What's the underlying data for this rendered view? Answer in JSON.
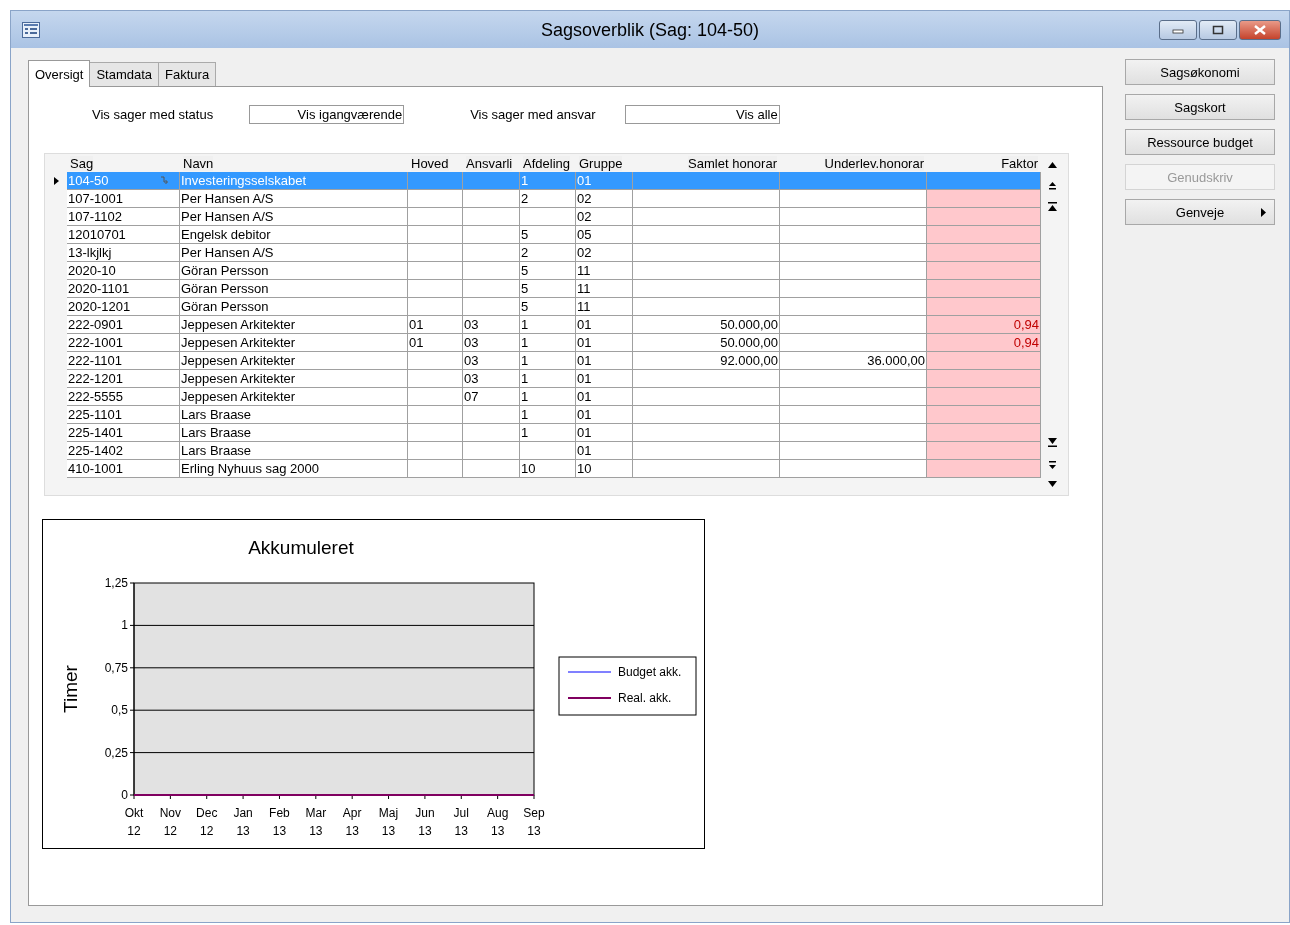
{
  "window": {
    "title": "Sagsoverblik (Sag: 104-50)"
  },
  "tabs": [
    {
      "label": "Oversigt",
      "selected": true
    },
    {
      "label": "Stamdata",
      "selected": false
    },
    {
      "label": "Faktura",
      "selected": false
    }
  ],
  "filters": [
    {
      "label": "Vis sager med status",
      "value": "Vis igangværende"
    },
    {
      "label": "Vis sager med ansvar",
      "value": "Vis alle"
    }
  ],
  "table": {
    "columns": [
      "Sag",
      "Navn",
      "Hoved",
      "Ansvarli",
      "Afdeling",
      "Gruppe",
      "Samlet honorar",
      "Underlev.honorar",
      "Faktor"
    ],
    "rows": [
      {
        "cells": [
          "104-50",
          "Investeringsselskabet",
          "",
          "",
          "1",
          "01",
          "",
          "",
          ""
        ],
        "selected": true
      },
      {
        "cells": [
          "107-1001",
          "Per Hansen A/S",
          "",
          "",
          "2",
          "02",
          "",
          "",
          ""
        ],
        "selected": false
      },
      {
        "cells": [
          "107-1102",
          "Per Hansen A/S",
          "",
          "",
          "",
          "02",
          "",
          "",
          ""
        ],
        "selected": false
      },
      {
        "cells": [
          "12010701",
          "Engelsk debitor",
          "",
          "",
          "5",
          "05",
          "",
          "",
          ""
        ],
        "selected": false
      },
      {
        "cells": [
          "13-lkjlkj",
          "Per Hansen A/S",
          "",
          "",
          "2",
          "02",
          "",
          "",
          ""
        ],
        "selected": false
      },
      {
        "cells": [
          "2020-10",
          "Göran Persson",
          "",
          "",
          "5",
          "11",
          "",
          "",
          ""
        ],
        "selected": false
      },
      {
        "cells": [
          "2020-1101",
          "Göran Persson",
          "",
          "",
          "5",
          "11",
          "",
          "",
          ""
        ],
        "selected": false
      },
      {
        "cells": [
          "2020-1201",
          "Göran Persson",
          "",
          "",
          "5",
          "11",
          "",
          "",
          ""
        ],
        "selected": false
      },
      {
        "cells": [
          "222-0901",
          "Jeppesen Arkitekter",
          "01",
          "03",
          "1",
          "01",
          "50.000,00",
          "",
          "0,94"
        ],
        "selected": false
      },
      {
        "cells": [
          "222-1001",
          "Jeppesen Arkitekter",
          "01",
          "03",
          "1",
          "01",
          "50.000,00",
          "",
          "0,94"
        ],
        "selected": false
      },
      {
        "cells": [
          "222-1101",
          "Jeppesen Arkitekter",
          "",
          "03",
          "1",
          "01",
          "92.000,00",
          "36.000,00",
          ""
        ],
        "selected": false
      },
      {
        "cells": [
          "222-1201",
          "Jeppesen Arkitekter",
          "",
          "03",
          "1",
          "01",
          "",
          "",
          ""
        ],
        "selected": false
      },
      {
        "cells": [
          "222-5555",
          "Jeppesen Arkitekter",
          "",
          "07",
          "1",
          "01",
          "",
          "",
          ""
        ],
        "selected": false
      },
      {
        "cells": [
          "225-1101",
          "Lars Braase",
          "",
          "",
          "1",
          "01",
          "",
          "",
          ""
        ],
        "selected": false
      },
      {
        "cells": [
          "225-1401",
          "Lars Braase",
          "",
          "",
          "1",
          "01",
          "",
          "",
          ""
        ],
        "selected": false
      },
      {
        "cells": [
          "225-1402",
          "Lars Braase",
          "",
          "",
          "",
          "01",
          "",
          "",
          ""
        ],
        "selected": false
      },
      {
        "cells": [
          "410-1001",
          "Erling Nyhuus sag 2000",
          "",
          "",
          "10",
          "10",
          "",
          "",
          ""
        ],
        "selected": false
      }
    ]
  },
  "chart": {
    "chart_data": {
      "type": "line",
      "title": "Akkumuleret",
      "ylabel": "Timer",
      "categories": [
        "Okt 12",
        "Nov 12",
        "Dec 12",
        "Jan 13",
        "Feb 13",
        "Mar 13",
        "Apr 13",
        "Maj 13",
        "Jun 13",
        "Jul 13",
        "Aug 13",
        "Sep 13"
      ],
      "series": [
        {
          "name": "Budget akk.",
          "color": "#8080ff",
          "values": [
            null,
            null,
            null,
            null,
            null,
            null,
            null,
            null,
            null,
            null,
            null,
            null
          ]
        },
        {
          "name": "Real. akk.",
          "color": "#800060",
          "values": [
            0,
            0,
            0,
            0,
            0,
            0,
            0,
            0,
            0,
            0,
            0,
            0
          ]
        }
      ],
      "ylim": [
        0,
        1.25
      ],
      "grid": true,
      "legend": "right",
      "yticks": [
        {
          "value": 0,
          "label": "0"
        },
        {
          "value": 0.25,
          "label": "0,25"
        },
        {
          "value": 0.5,
          "label": "0,5"
        },
        {
          "value": 0.75,
          "label": "0,75"
        },
        {
          "value": 1,
          "label": "1"
        },
        {
          "value": 1.25,
          "label": "1,25"
        }
      ]
    }
  },
  "buttons": [
    {
      "label": "Sagsøkonomi",
      "disabled": false
    },
    {
      "label": "Sagskort",
      "disabled": false
    },
    {
      "label": "Ressource budget",
      "disabled": false
    },
    {
      "label": "Genudskriv",
      "disabled": true
    },
    {
      "label": "Genveje",
      "disabled": false,
      "kind": "menu"
    }
  ]
}
